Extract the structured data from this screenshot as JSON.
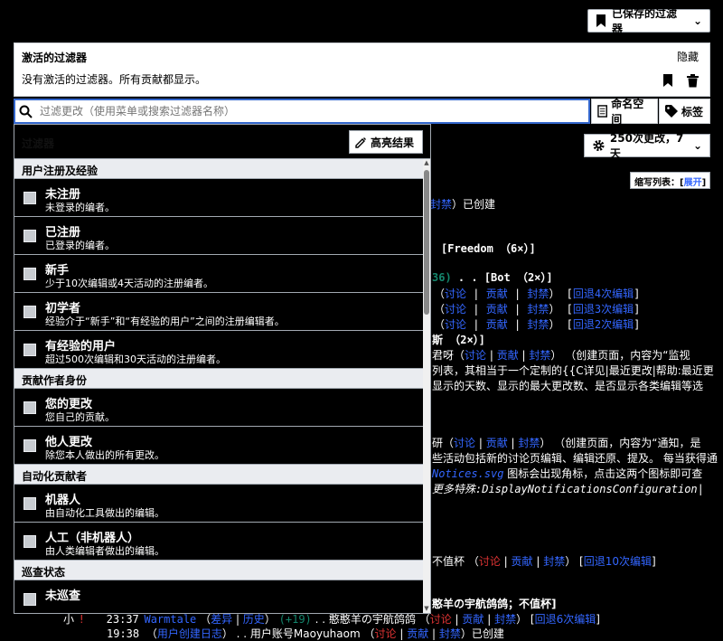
{
  "saved_filters_label": "已保存的过滤器",
  "active_filters": {
    "title": "激活的过滤器",
    "description": "没有激活的过滤器。所有贡献都显示。",
    "hide_label": "隐藏"
  },
  "search": {
    "placeholder": "过滤更改（使用菜单或搜索过滤器名称）",
    "namespace_label": "命名空间",
    "tags_label": "标签"
  },
  "menu": {
    "header_label": "过滤器",
    "highlight_label": "高亮结果",
    "groups": [
      {
        "title": "用户注册及经验",
        "items": [
          {
            "title": "未注册",
            "desc": "未登录的编者。"
          },
          {
            "title": "已注册",
            "desc": "已登录的编者。"
          },
          {
            "title": "新手",
            "desc": "少于10次编辑或4天活动的注册编者。"
          },
          {
            "title": "初学者",
            "desc": "经验介于“新手”和“有经验的用户”之间的注册编辑者。"
          },
          {
            "title": "有经验的用户",
            "desc": "超过500次编辑和30天活动的注册编者。"
          }
        ]
      },
      {
        "title": "贡献作者身份",
        "items": [
          {
            "title": "您的更改",
            "desc": "您自己的贡献。"
          },
          {
            "title": "他人更改",
            "desc": "除您本人做出的所有更改。"
          }
        ]
      },
      {
        "title": "自动化贡献者",
        "items": [
          {
            "title": "机器人",
            "desc": "由自动化工具做出的编辑。"
          },
          {
            "title": "人工（非机器人）",
            "desc": "由人类编辑者做出的编辑。"
          }
        ]
      },
      {
        "title": "巡查状态",
        "items": [
          {
            "title": "未巡查",
            "desc": ""
          }
        ]
      }
    ]
  },
  "changes_label": "250次更改，7天",
  "legend": {
    "label": "缩写列表：",
    "expand": "展开"
  },
  "feed": {
    "l1_link": "封禁",
    "l1_text": "）已创建",
    "l2": "[Freedom （6×）]",
    "l3a": "36)",
    "l3b": ". . [Bot （2×）]",
    "rowlinks": {
      "talk": "讨论",
      "contribs": "贡献",
      "block": "封禁"
    },
    "rollback4": "回退4次编辑",
    "rollback3": "回退3次编辑",
    "rollback2": "回退2次编辑",
    "l7": "斯 （2×）]",
    "l8a": "君呀",
    "l8b": "（创建页面，内容为“监视",
    "l9": "列表，其相当于一个定制的{{C详见|最近更改|帮助:最近更",
    "l10": "显示的天数、显示的最大更改数、是否显示各类编辑等选",
    "l11a": "研",
    "l11b": "（创建页面，内容为“通知，是",
    "l12": "些活动包括新的讨论页编辑、编辑还原、提及。 每当获得通",
    "l13a": "Notices.svg",
    "l13b": " 图标会出现角标，点击这两个图标即可查",
    "l14": "更多特殊:DisplayNotificationsConfiguration|",
    "l15a": "不值杯",
    "rollback10": "回退10次编辑",
    "l16": "憨羊の宇航鸽鸽；不值杯]",
    "l17_time": "23:37",
    "l17_user": "Warmtale",
    "l17_diff": "差异",
    "l17_hist": "历史",
    "l17_delta": "(+19)",
    "l17_text": ". . 憨憨羊の宇航鸽鸽",
    "rollback6": "回退6次编辑",
    "l18_time": "19:38",
    "l18_tag": "用户创建日志",
    "l18_text": ". . 用户账号Maoyuhaom",
    "l18_end": "已创建"
  }
}
